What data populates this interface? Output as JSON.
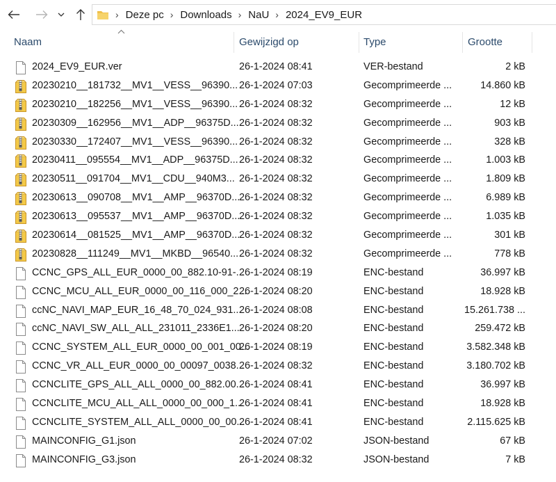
{
  "address": {
    "breadcrumbs": [
      "Deze pc",
      "Downloads",
      "NaU",
      "2024_EV9_EUR"
    ]
  },
  "columns": {
    "name": "Naam",
    "modified": "Gewijzigd op",
    "type": "Type",
    "size": "Grootte"
  },
  "files": [
    {
      "icon": "file-icon",
      "name": "2024_EV9_EUR.ver",
      "modified": "26-1-2024 08:41",
      "type": "VER-bestand",
      "size": "2 kB"
    },
    {
      "icon": "zip-icon",
      "name": "20230210__181732__MV1__VESS__96390...",
      "modified": "26-1-2024 07:03",
      "type": "Gecomprimeerde ...",
      "size": "14.860 kB"
    },
    {
      "icon": "zip-icon",
      "name": "20230210__182256__MV1__VESS__96390...",
      "modified": "26-1-2024 08:32",
      "type": "Gecomprimeerde ...",
      "size": "12 kB"
    },
    {
      "icon": "zip-icon",
      "name": "20230309__162956__MV1__ADP__96375D...",
      "modified": "26-1-2024 08:32",
      "type": "Gecomprimeerde ...",
      "size": "903 kB"
    },
    {
      "icon": "zip-icon",
      "name": "20230330__172407__MV1__VESS__96390...",
      "modified": "26-1-2024 08:32",
      "type": "Gecomprimeerde ...",
      "size": "328 kB"
    },
    {
      "icon": "zip-icon",
      "name": "20230411__095554__MV1__ADP__96375D...",
      "modified": "26-1-2024 08:32",
      "type": "Gecomprimeerde ...",
      "size": "1.003 kB"
    },
    {
      "icon": "zip-icon",
      "name": "20230511__091704__MV1__CDU__940M3...",
      "modified": "26-1-2024 08:32",
      "type": "Gecomprimeerde ...",
      "size": "1.809 kB"
    },
    {
      "icon": "zip-icon",
      "name": "20230613__090708__MV1__AMP__96370D...",
      "modified": "26-1-2024 08:32",
      "type": "Gecomprimeerde ...",
      "size": "6.989 kB"
    },
    {
      "icon": "zip-icon",
      "name": "20230613__095537__MV1__AMP__96370D...",
      "modified": "26-1-2024 08:32",
      "type": "Gecomprimeerde ...",
      "size": "1.035 kB"
    },
    {
      "icon": "zip-icon",
      "name": "20230614__081525__MV1__AMP__96370D...",
      "modified": "26-1-2024 08:32",
      "type": "Gecomprimeerde ...",
      "size": "301 kB"
    },
    {
      "icon": "zip-icon",
      "name": "20230828__111249__MV1__MKBD__96540...",
      "modified": "26-1-2024 08:32",
      "type": "Gecomprimeerde ...",
      "size": "778 kB"
    },
    {
      "icon": "file-icon",
      "name": "CCNC_GPS_ALL_EUR_0000_00_882.10-91-...",
      "modified": "26-1-2024 08:19",
      "type": "ENC-bestand",
      "size": "36.997 kB"
    },
    {
      "icon": "file-icon",
      "name": "CCNC_MCU_ALL_EUR_0000_00_116_000_2...",
      "modified": "26-1-2024 08:20",
      "type": "ENC-bestand",
      "size": "18.928 kB"
    },
    {
      "icon": "file-icon",
      "name": "ccNC_NAVI_MAP_EUR_16_48_70_024_931...",
      "modified": "26-1-2024 08:08",
      "type": "ENC-bestand",
      "size": "15.261.738 ..."
    },
    {
      "icon": "file-icon",
      "name": "ccNC_NAVI_SW_ALL_ALL_231011_2336E1...",
      "modified": "26-1-2024 08:20",
      "type": "ENC-bestand",
      "size": "259.472 kB"
    },
    {
      "icon": "file-icon",
      "name": "CCNC_SYSTEM_ALL_EUR_0000_00_001_00...",
      "modified": "26-1-2024 08:19",
      "type": "ENC-bestand",
      "size": "3.582.348 kB"
    },
    {
      "icon": "file-icon",
      "name": "CCNC_VR_ALL_EUR_0000_00_00097_0038...",
      "modified": "26-1-2024 08:32",
      "type": "ENC-bestand",
      "size": "3.180.702 kB"
    },
    {
      "icon": "file-icon",
      "name": "CCNCLITE_GPS_ALL_ALL_0000_00_882.00...",
      "modified": "26-1-2024 08:41",
      "type": "ENC-bestand",
      "size": "36.997 kB"
    },
    {
      "icon": "file-icon",
      "name": "CCNCLITE_MCU_ALL_ALL_0000_00_000_1...",
      "modified": "26-1-2024 08:41",
      "type": "ENC-bestand",
      "size": "18.928 kB"
    },
    {
      "icon": "file-icon",
      "name": "CCNCLITE_SYSTEM_ALL_ALL_0000_00_00...",
      "modified": "26-1-2024 08:41",
      "type": "ENC-bestand",
      "size": "2.115.625 kB"
    },
    {
      "icon": "file-icon",
      "name": "MAINCONFIG_G1.json",
      "modified": "26-1-2024 07:02",
      "type": "JSON-bestand",
      "size": "67 kB"
    },
    {
      "icon": "file-icon",
      "name": "MAINCONFIG_G3.json",
      "modified": "26-1-2024 08:32",
      "type": "JSON-bestand",
      "size": "7 kB"
    }
  ],
  "colors": {
    "header_text": "#2b4a6b",
    "folder_yellow": "#f0c04a",
    "zip_yellow": "#f3c948"
  }
}
